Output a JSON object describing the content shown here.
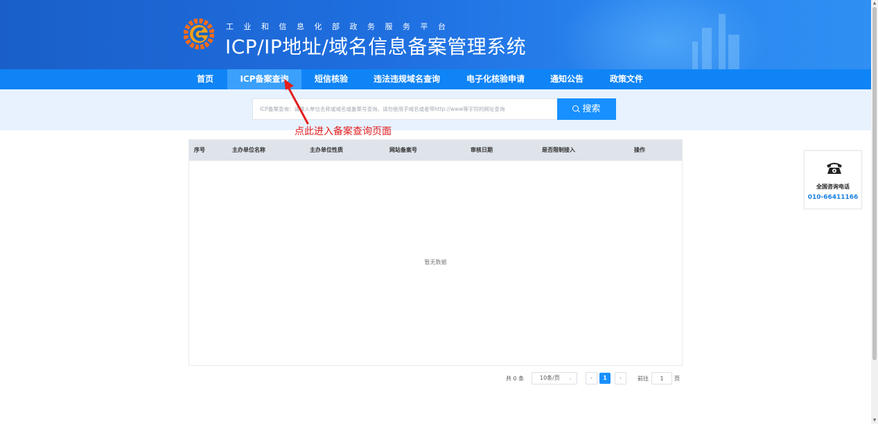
{
  "header": {
    "subtitle": "工业和信息化部政务服务平台",
    "title": "ICP/IP地址/域名信息备案管理系统"
  },
  "nav": {
    "items": [
      {
        "label": "首页"
      },
      {
        "label": "ICP备案查询",
        "active": true
      },
      {
        "label": "短信核验"
      },
      {
        "label": "违法违规域名查询"
      },
      {
        "label": "电子化核验申请"
      },
      {
        "label": "通知公告"
      },
      {
        "label": "政策文件"
      }
    ]
  },
  "search": {
    "placeholder": "ICP备案查询：请输入单位名称或域名或备案号查询，请勿使用子域名或者带http://www等字符的网址查询",
    "button_label": "搜索"
  },
  "annotation": {
    "text": "点此进入备案查询页面",
    "color": "#e31d1d"
  },
  "table": {
    "columns": [
      "序号",
      "主办单位名称",
      "主办单位性质",
      "网站备案号",
      "审核日期",
      "是否限制接入",
      "操作"
    ],
    "rows": [],
    "empty_text": "暂无数据"
  },
  "pagination": {
    "total_text": "共 0 条",
    "page_size": "10条/页",
    "current_page": "1",
    "goto_label": "前往",
    "goto_value": "1",
    "page_suffix": "页"
  },
  "side_widget": {
    "icon": "telephone-icon",
    "label": "全国咨询电话",
    "phone": "010-66411166"
  },
  "colors": {
    "nav_bg": "#0f84f6",
    "nav_active": "#3aa0fb",
    "primary": "#1890ff",
    "search_band": "#e7f2fe"
  }
}
